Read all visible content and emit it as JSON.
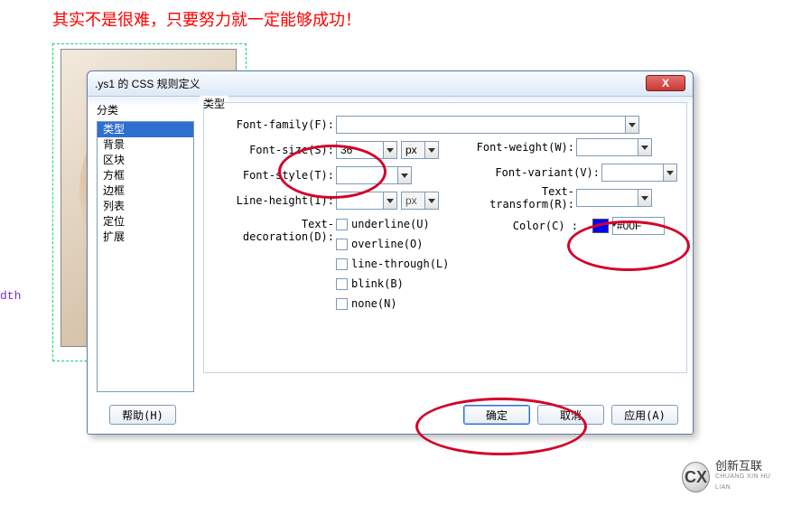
{
  "banner": "其实不是很难，只要努力就一定能够成功！",
  "stray": "dth",
  "dialog": {
    "title": ".ys1 的 CSS 规则定义",
    "close_x": "X",
    "category_label": "分类",
    "type_label": "类型",
    "categories": [
      "类型",
      "背景",
      "区块",
      "方框",
      "边框",
      "列表",
      "定位",
      "扩展"
    ],
    "selected_category_index": 0,
    "fields": {
      "font_family_label": "Font-family(F):",
      "font_family_value": "",
      "font_size_label": "Font-size(S):",
      "font_size_value": "36",
      "font_size_unit": "px",
      "font_style_label": "Font-style(T):",
      "font_style_value": "",
      "line_height_label": "Line-height(I):",
      "line_height_value": "",
      "line_height_unit": "px",
      "font_weight_label": "Font-weight(W):",
      "font_weight_value": "",
      "font_variant_label": "Font-variant(V):",
      "font_variant_value": "",
      "text_transform_label": "Text-transform(R):",
      "text_transform_value": "",
      "color_label": "Color(C) :",
      "color_value": "#00F",
      "color_hex": "#0000FF",
      "text_decoration_label": "Text-decoration(D):",
      "decorations": {
        "underline": "underline(U)",
        "overline": "overline(O)",
        "line_through": "line-through(L)",
        "blink": "blink(B)",
        "none": "none(N)"
      }
    },
    "buttons": {
      "help": "帮助(H)",
      "ok": "确定",
      "cancel": "取消",
      "apply": "应用(A)"
    }
  },
  "logo": {
    "cn": "创新互联",
    "en": "CHUANG XIN HU LIAN"
  }
}
